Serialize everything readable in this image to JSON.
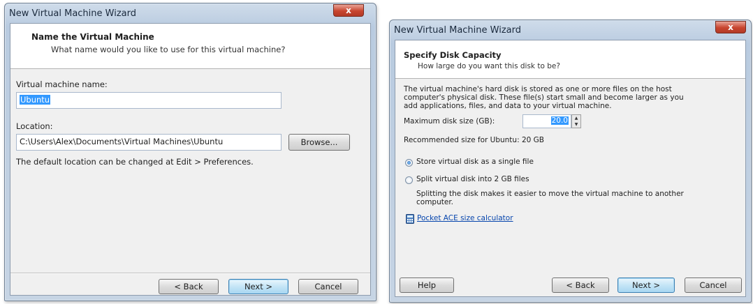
{
  "left_window": {
    "title": "New Virtual Machine Wizard",
    "close_label": "x",
    "header_title": "Name the Virtual Machine",
    "header_subtitle": "What name would you like to use for this virtual machine?",
    "name_label": "Virtual machine name:",
    "name_value": "Ubuntu",
    "location_label": "Location:",
    "location_value": "C:\\Users\\Alex\\Documents\\Virtual Machines\\Ubuntu",
    "browse_label": "Browse...",
    "note": "The default location can be changed at Edit > Preferences.",
    "back_label": "< Back",
    "next_label": "Next >",
    "cancel_label": "Cancel"
  },
  "right_window": {
    "title": "New Virtual Machine Wizard",
    "close_label": "x",
    "header_title": "Specify Disk Capacity",
    "header_subtitle": "How large do you want this disk to be?",
    "description": [
      "The virtual machine's hard disk is stored as one or more files on the host",
      "computer's physical disk. These file(s) start small and become larger as you",
      "add applications, files, and data to your virtual machine."
    ],
    "max_size_label": "Maximum disk size (GB):",
    "max_size_value": "20.0",
    "recommended": "Recommended size for Ubuntu: 20 GB",
    "option_single": "Store virtual disk as a single file",
    "option_split": "Split virtual disk into 2 GB files",
    "split_note": [
      "Splitting the disk makes it easier to move the virtual machine to another",
      "computer."
    ],
    "calculator_link": "Pocket ACE size calculator",
    "help_label": "Help",
    "back_label": "< Back",
    "next_label": "Next >",
    "cancel_label": "Cancel",
    "selected_option": "single"
  }
}
